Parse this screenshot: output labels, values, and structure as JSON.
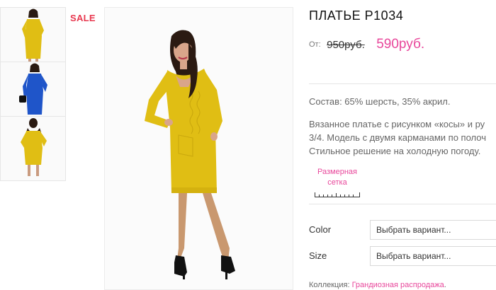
{
  "gallery": {
    "thumbnails": [
      {
        "label": "yellow-dress-front",
        "color": "#e0be14"
      },
      {
        "label": "blue-dress",
        "color": "#1f55c9"
      },
      {
        "label": "yellow-dress-back",
        "color": "#e0be14"
      }
    ],
    "sale_badge": "SALE",
    "main_image": "yellow-dress-model"
  },
  "product": {
    "title": "ПЛАТЬЕ P1034",
    "price_from_label": "От:",
    "price_old": "950руб.",
    "price_new": "590руб.",
    "composition": "Состав: 65% шерсть, 35% акрил.",
    "description_lines": [
      "Вязанное платье с рисунком «косы» и ру",
      "3/4. Модель с двумя карманами по полоч",
      "Стильное решение на холодную погоду."
    ],
    "size_chart": {
      "line1": "Размерная",
      "line2": "сетка"
    },
    "options": [
      {
        "label": "Color",
        "value": "Выбрать вариант..."
      },
      {
        "label": "Size",
        "value": "Выбрать вариант..."
      }
    ],
    "collection_label": "Коллекция:",
    "collection_link": "Грандиозная распродажа",
    "collection_suffix": "."
  },
  "colors": {
    "accent": "#e8479b",
    "sale": "#e8384f",
    "dress_yellow": "#e0be14",
    "dress_blue": "#1f55c9"
  }
}
